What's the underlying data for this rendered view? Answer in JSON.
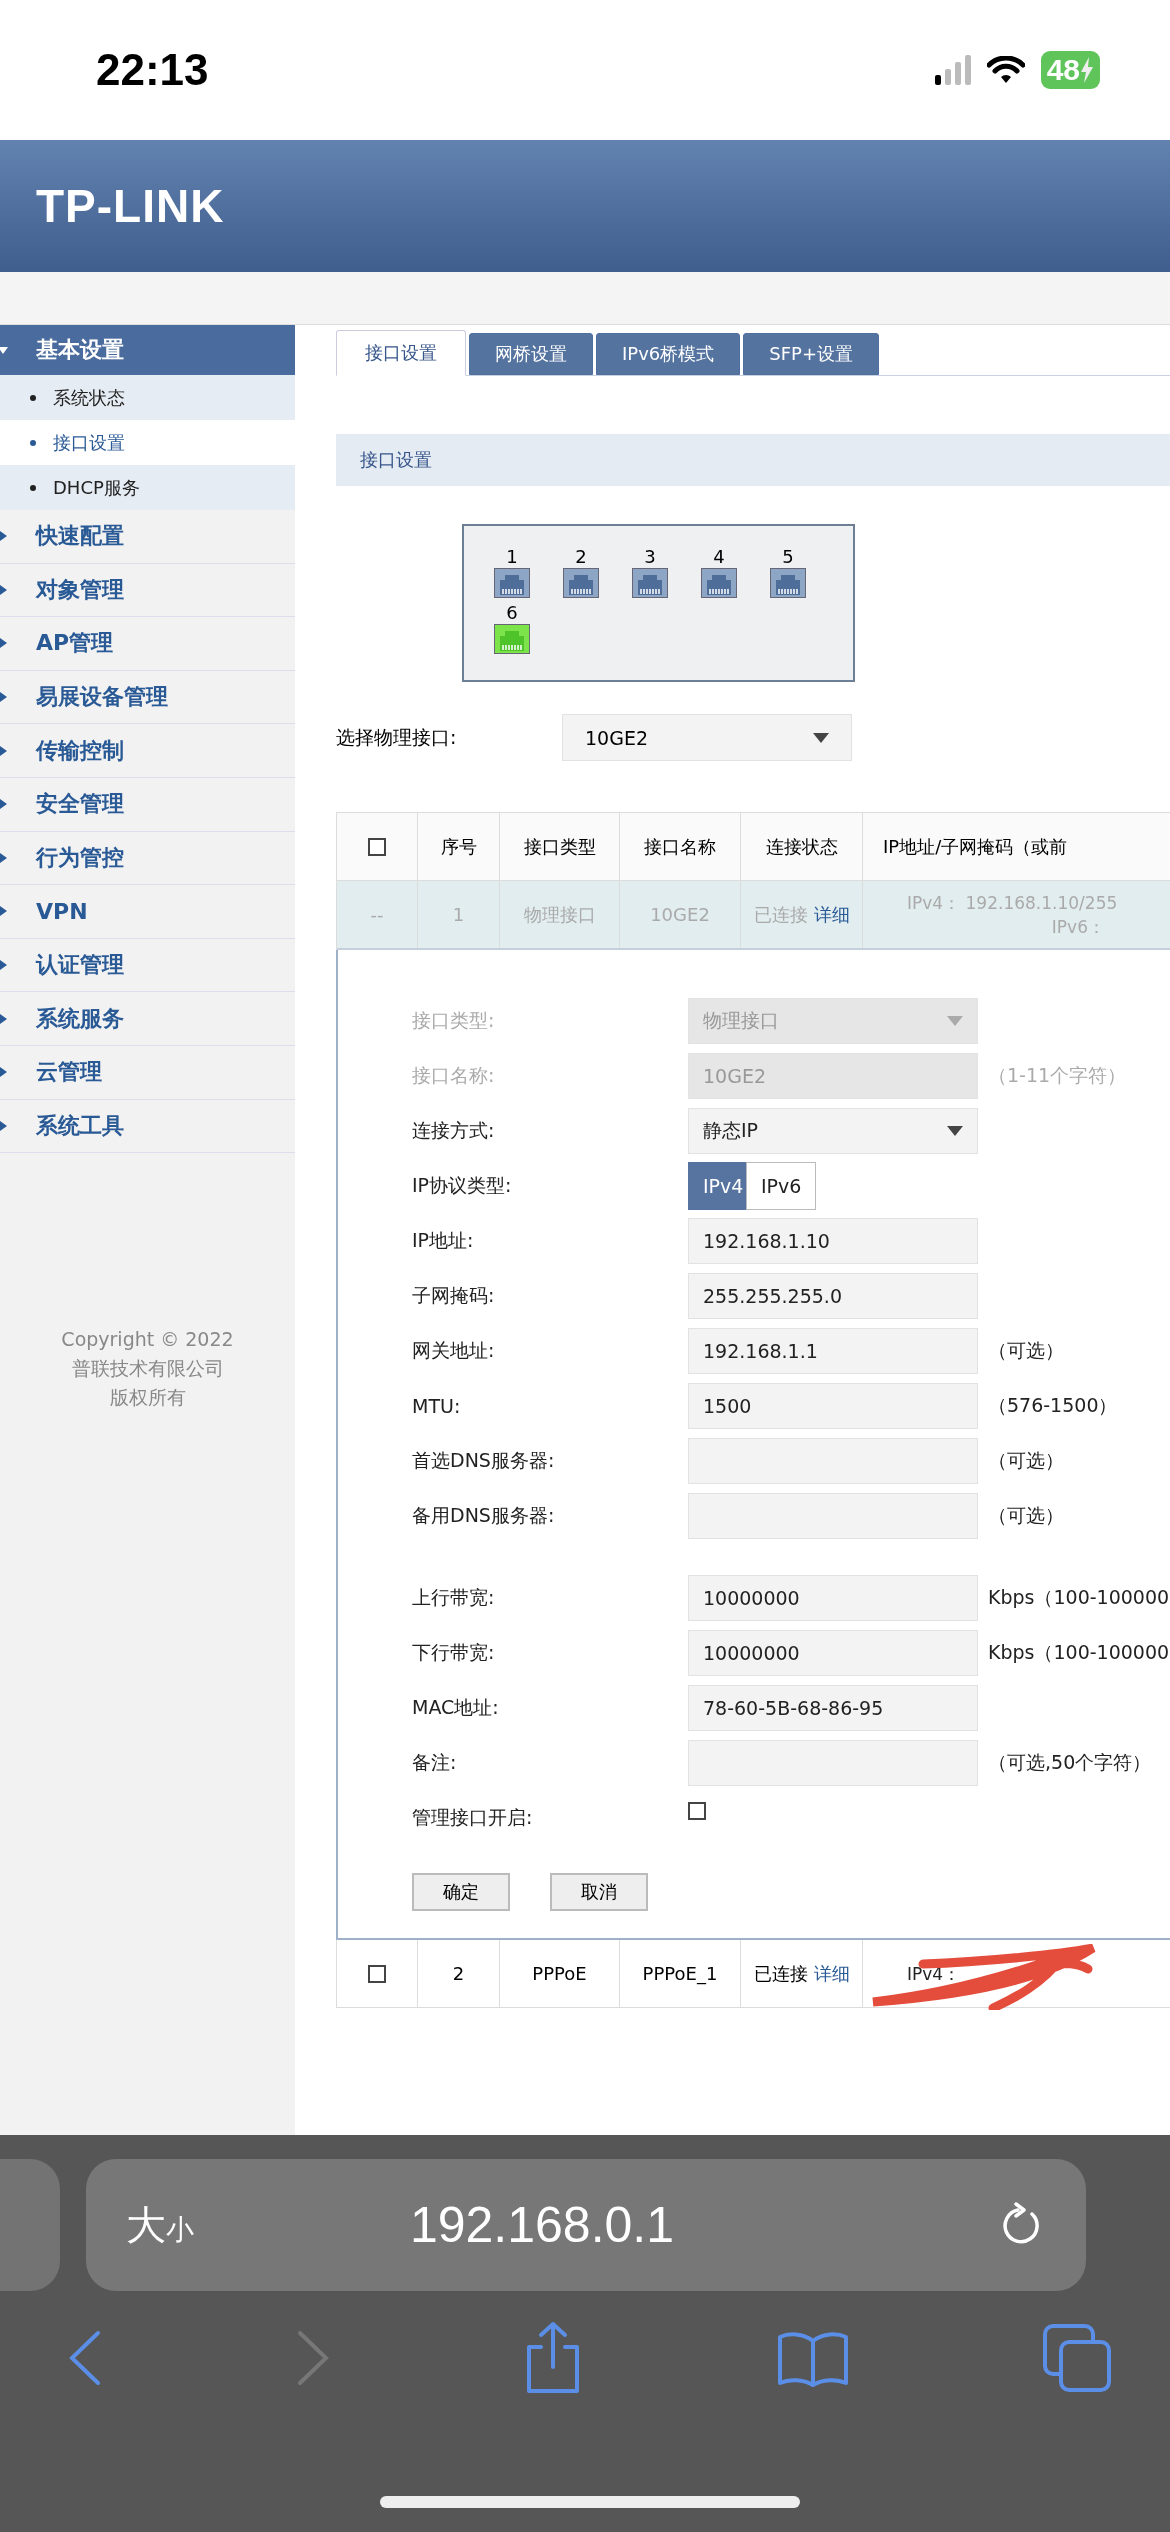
{
  "status_bar": {
    "time": "22:13",
    "battery": "48"
  },
  "header": {
    "logo": "TP-LINK"
  },
  "sidebar": {
    "items": [
      {
        "label": "基本设置",
        "expanded": true,
        "children": [
          {
            "label": "系统状态",
            "selected": false
          },
          {
            "label": "接口设置",
            "selected": true
          },
          {
            "label": "DHCP服务",
            "selected": false
          }
        ]
      },
      {
        "label": "快速配置",
        "expanded": false
      },
      {
        "label": "对象管理",
        "expanded": false
      },
      {
        "label": "AP管理",
        "expanded": false
      },
      {
        "label": "易展设备管理",
        "expanded": false
      },
      {
        "label": "传输控制",
        "expanded": false
      },
      {
        "label": "安全管理",
        "expanded": false
      },
      {
        "label": "行为管控",
        "expanded": false
      },
      {
        "label": "VPN",
        "expanded": false
      },
      {
        "label": "认证管理",
        "expanded": false
      },
      {
        "label": "系统服务",
        "expanded": false
      },
      {
        "label": "云管理",
        "expanded": false
      },
      {
        "label": "系统工具",
        "expanded": false
      }
    ],
    "copyright": [
      "Copyright © 2022",
      "普联技术有限公司",
      "版权所有"
    ]
  },
  "tabs": [
    {
      "label": "接口设置",
      "selected": true
    },
    {
      "label": "网桥设置",
      "selected": false
    },
    {
      "label": "IPv6桥模式",
      "selected": false
    },
    {
      "label": "SFP+设置",
      "selected": false
    }
  ],
  "section_title": "接口设置",
  "ports": [
    {
      "label": "1",
      "connected": false
    },
    {
      "label": "2",
      "connected": false
    },
    {
      "label": "3",
      "connected": false
    },
    {
      "label": "4",
      "connected": false
    },
    {
      "label": "5",
      "connected": false
    },
    {
      "label": "6",
      "connected": true
    }
  ],
  "port_select": {
    "label": "选择物理接口:",
    "value": "10GE2"
  },
  "table": {
    "columns": [
      "序号",
      "接口类型",
      "接口名称",
      "连接状态",
      "IP地址/子网掩码（或前"
    ],
    "all_checked": false,
    "rows": [
      {
        "checkbox": "--",
        "number": "1",
        "type": "物理接口",
        "name": "10GE2",
        "status": "已连接",
        "link": "详细",
        "ip_lines": [
          "IPv4：  192.168.1.10/255",
          "IPv6："
        ],
        "expanded": true
      },
      {
        "number": "2",
        "type": "PPPoE",
        "name": "PPPoE_1",
        "status": "已连接",
        "link": "详细",
        "ip_lines": [
          "IPv4："
        ],
        "expanded": false,
        "checked": false,
        "redacted": true
      }
    ]
  },
  "form": {
    "rows": [
      {
        "kind": "select",
        "label": "接口类型:",
        "value": "物理接口",
        "disabled": true
      },
      {
        "kind": "input",
        "label": "接口名称:",
        "value": "10GE2",
        "hint": "（1-11个字符）",
        "disabled": true
      },
      {
        "kind": "select",
        "label": "连接方式:",
        "value": "静态IP",
        "disabled": false
      },
      {
        "kind": "toggle",
        "label": "IP协议类型:",
        "options": [
          {
            "label": "IPv4",
            "selected": true
          },
          {
            "label": "IPv6",
            "selected": false
          }
        ]
      },
      {
        "kind": "input",
        "label": "IP地址:",
        "value": "192.168.1.10",
        "disabled": false
      },
      {
        "kind": "input",
        "label": "子网掩码:",
        "value": "255.255.255.0",
        "disabled": false
      },
      {
        "kind": "input",
        "label": "网关地址:",
        "value": "192.168.1.1",
        "hint": "（可选）",
        "disabled": false
      },
      {
        "kind": "input",
        "label": "MTU:",
        "value": "1500",
        "hint": "（576-1500）",
        "disabled": false
      },
      {
        "kind": "input",
        "label": "首选DNS服务器:",
        "hint": "（可选）",
        "disabled": false
      },
      {
        "kind": "input",
        "label": "备用DNS服务器:",
        "hint": "（可选）",
        "disabled": false
      },
      {
        "kind": "spacer"
      },
      {
        "kind": "input",
        "label": "上行带宽:",
        "value": "10000000",
        "hint": "Kbps（100-100000",
        "disabled": false
      },
      {
        "kind": "input",
        "label": "下行带宽:",
        "value": "10000000",
        "hint": "Kbps（100-100000",
        "disabled": false
      },
      {
        "kind": "input",
        "label": "MAC地址:",
        "value": "78-60-5B-68-86-95",
        "disabled": false
      },
      {
        "kind": "input",
        "label": "备注:",
        "hint": "（可选,50个字符）",
        "disabled": false
      },
      {
        "kind": "checkbox",
        "label": "管理接口开启:",
        "checked": false
      }
    ],
    "buttons": [
      "确定",
      "取消"
    ]
  },
  "browser": {
    "text_size": "大小",
    "url": "192.168.0.1"
  }
}
